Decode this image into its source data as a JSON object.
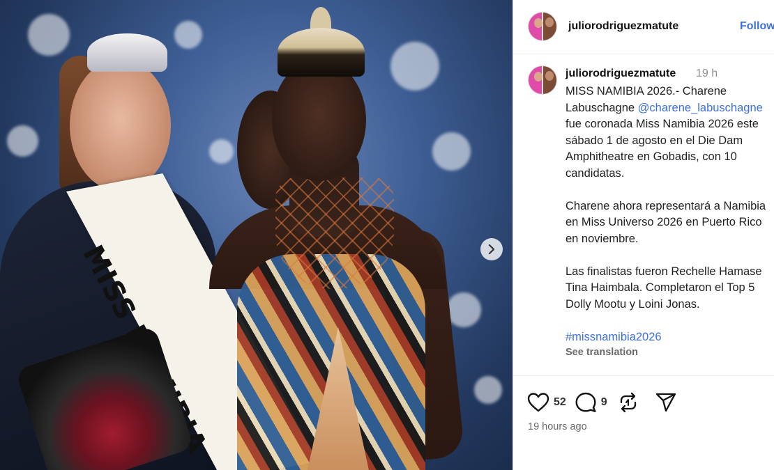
{
  "post": {
    "image_alt_semantics": "crowning-photo",
    "carousel_next_icon": "chevron-right-icon"
  },
  "header": {
    "username": "juliorodriguezmatute",
    "follow_label": "Follow"
  },
  "caption": {
    "username": "juliorodriguezmatute",
    "time": "19 h",
    "lines_p1": [
      "MISS NAMIBIA 2026.- Charene",
      "Labuschagne "
    ],
    "mention": "@charene_labuschagne",
    "lines_p1b": [
      "fue coronada Miss Namibia 2026 este",
      "sábado 1 de agosto en el Die Dam",
      "Amphitheatre en Gobadis, con 10",
      "candidatas."
    ],
    "lines_p2": [
      "Charene ahora representará a Namibia",
      "en Miss Universo 2026 en Puerto Rico",
      "en noviembre."
    ],
    "lines_p3": [
      "Las finalistas fueron Rechelle Hamase",
      "Tina Haimbala. Completaron el Top 5",
      "Dolly Mootu y Loini Jonas."
    ],
    "hashtag": "#missnamibia2026",
    "see_translation": "See translation"
  },
  "photo_text": {
    "sash": "MISS NAMIBIA"
  },
  "actions": {
    "likes": "52",
    "comments": "9",
    "icons": [
      "heart-icon",
      "comment-icon",
      "repost-icon",
      "share-icon"
    ]
  },
  "timestamp": "19 hours ago",
  "colors": {
    "link": "#3d6fe0",
    "muted": "#8e8e8e",
    "border": "#dbdbdb"
  }
}
